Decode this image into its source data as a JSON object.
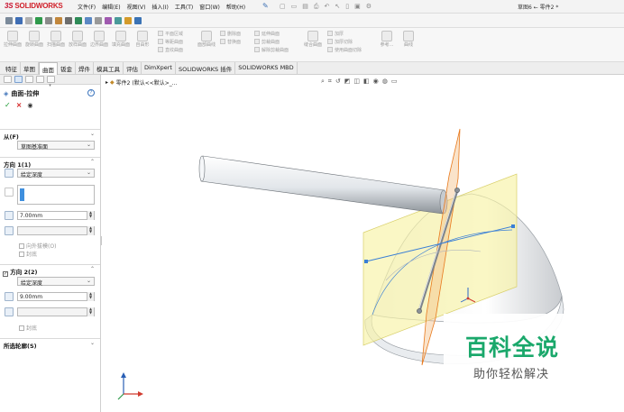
{
  "app": {
    "logo_prefix": "3S",
    "logo": "SOLIDWORKS",
    "document_title": "草图6 ← 零件2 *"
  },
  "menus": [
    "文件(F)",
    "编辑(E)",
    "视图(V)",
    "插入(I)",
    "工具(T)",
    "窗口(W)",
    "帮助(H)"
  ],
  "command_manager": {
    "big_buttons": [
      "拉伸曲面",
      "旋转曲面",
      "扫描曲面",
      "放样曲面",
      "边界曲面",
      "填充曲面",
      "自由形"
    ],
    "col1": [
      "平面区域",
      "等距曲面",
      "直纹曲面"
    ],
    "single": "面部曲线",
    "col2": [
      "删除面",
      "替换面"
    ],
    "col3": [
      "延伸曲面",
      "剪裁曲面",
      "解除剪裁曲面"
    ],
    "knit": "缝合曲面",
    "col4": [
      "加厚",
      "加厚切除",
      "使用曲面切除"
    ],
    "ref": "参考...",
    "curves": "曲线"
  },
  "tabs": [
    {
      "label": "特征",
      "active": false
    },
    {
      "label": "草图",
      "active": false
    },
    {
      "label": "曲面",
      "active": true
    },
    {
      "label": "钣金",
      "active": false
    },
    {
      "label": "焊件",
      "active": false
    },
    {
      "label": "模具工具",
      "active": false
    },
    {
      "label": "评估",
      "active": false
    },
    {
      "label": "DimXpert",
      "active": false
    },
    {
      "label": "SOLIDWORKS 插件",
      "active": false
    },
    {
      "label": "SOLIDWORKS MBD",
      "active": false
    }
  ],
  "property_manager": {
    "title": "曲面-拉伸",
    "help": "?",
    "from": {
      "label": "从(F)",
      "value": "草图基准面"
    },
    "dir1": {
      "label": "方向 1(1)",
      "end_condition": "给定深度",
      "depth": "7.00mm",
      "draft_outward": "向外拔模(O)",
      "cap_end": "封底"
    },
    "dir2": {
      "label": "方向 2(2)",
      "end_condition": "给定深度",
      "depth": "9.00mm",
      "cap_end": "封底"
    },
    "selected_contours": "所选轮廓(S)"
  },
  "viewport": {
    "tree_path": "零件2 (默认<<默认>_..."
  },
  "watermark": {
    "main": "百科全说",
    "sub": "助你轻松解决"
  },
  "colors": {
    "accent": "#3f8fde",
    "sketch_plane": "#f7f3a6",
    "orange_plane": "#e87a1e",
    "watermark": "#1aa86b"
  }
}
